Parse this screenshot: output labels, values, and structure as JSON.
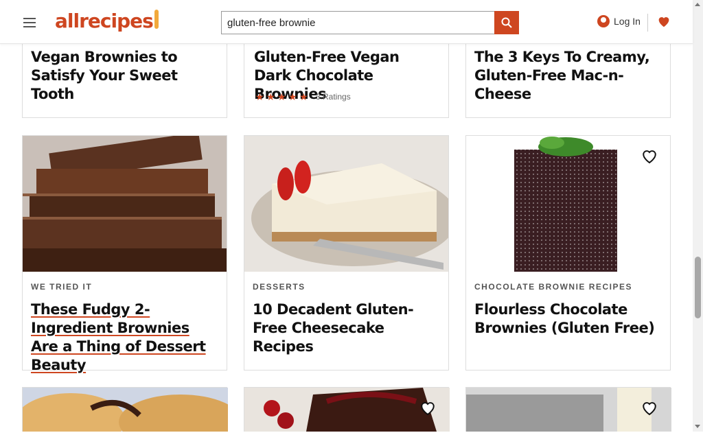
{
  "header": {
    "logo": "allrecipes",
    "search_value": "gluten-free brownie",
    "login_label": "Log In"
  },
  "top_cards": [
    {
      "title": "Vegan Brownies to Satisfy Your Sweet Tooth"
    },
    {
      "title": "Gluten-Free Vegan Dark Chocolate Brownies",
      "ratings": "3 Ratings",
      "stars": 5
    },
    {
      "title": "The 3 Keys To Creamy, Gluten-Free Mac-n-Cheese"
    }
  ],
  "cards": [
    {
      "kicker": "WE TRIED IT",
      "title": "These Fudgy 2-Ingredient Brownies Are a Thing of Dessert Beauty"
    },
    {
      "kicker": "DESSERTS",
      "title": "10 Decadent Gluten-Free Cheesecake Recipes"
    },
    {
      "kicker": "CHOCOLATE BROWNIE RECIPES",
      "title": "Flourless Chocolate Brownies (Gluten Free)"
    }
  ],
  "colors": {
    "brand": "#ce4620"
  }
}
